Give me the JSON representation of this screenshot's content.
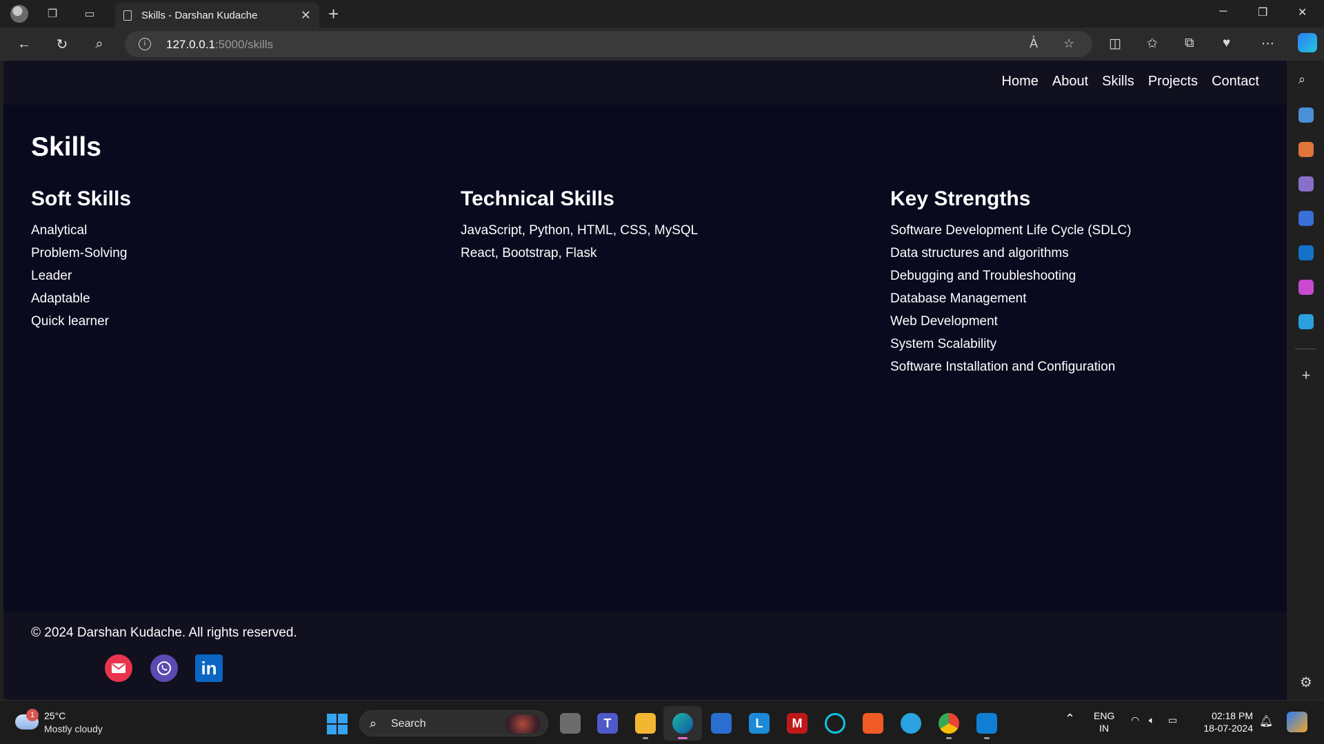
{
  "browser": {
    "tab_title": "Skills - Darshan Kudache",
    "url_host": "127.0.0.1",
    "url_path": ":5000/skills"
  },
  "site": {
    "nav": [
      "Home",
      "About",
      "Skills",
      "Projects",
      "Contact"
    ],
    "page_title": "Skills",
    "columns": [
      {
        "heading": "Soft Skills",
        "items": [
          "Analytical",
          "Problem-Solving",
          "Leader",
          "Adaptable",
          "Quick learner"
        ]
      },
      {
        "heading": "Technical Skills",
        "items": [
          "JavaScript, Python, HTML, CSS, MySQL",
          "React, Bootstrap, Flask"
        ]
      },
      {
        "heading": "Key Strengths",
        "items": [
          "Software Development Life Cycle (SDLC)",
          "Data structures and algorithms",
          "Debugging and Troubleshooting",
          "Database Management",
          "Web Development",
          "System Scalability",
          "Software Installation and Configuration"
        ]
      }
    ],
    "footer_text": "© 2024 Darshan Kudache. All rights reserved.",
    "social_icons": [
      "mail-icon",
      "viber-icon",
      "linkedin-icon"
    ],
    "linkedin_glyph": "in"
  },
  "taskbar": {
    "weather_badge": "1",
    "temperature": "25°C",
    "condition": "Mostly cloudy",
    "search_label": "Search",
    "lang_top": "ENG",
    "lang_bottom": "IN",
    "time": "02:18 PM",
    "date": "18-07-2024"
  },
  "colors": {
    "page_bg": "#0a0a1f",
    "nav_bg": "#10101f",
    "mail": "#e8344e",
    "viber": "#5b4ab0",
    "linkedin": "#0a66c2"
  }
}
